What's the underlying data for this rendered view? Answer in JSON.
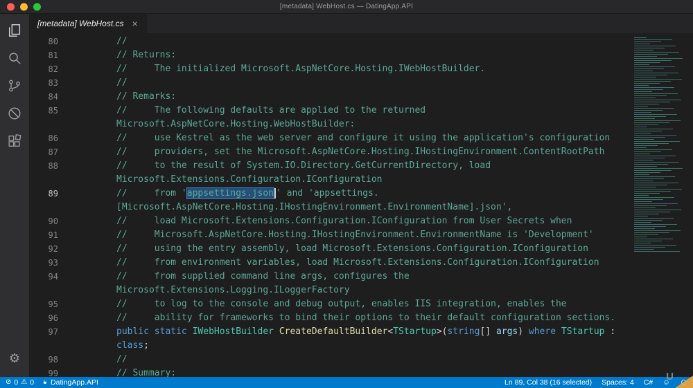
{
  "title_bar": {
    "title": "[metadata] WebHost.cs — DatingApp.API"
  },
  "tab": {
    "label": "[metadata] WebHost.cs"
  },
  "icons": {
    "close": "×",
    "gear": "⚙",
    "error": "⊘",
    "warning": "⚠",
    "smiley": "☺"
  },
  "activity_bar": {
    "icons": [
      "explorer",
      "search",
      "source-control",
      "debug",
      "extensions"
    ],
    "bottom": "settings-gear"
  },
  "editor": {
    "rows": [
      {
        "n": "80",
        "segs": [
          {
            "t": "//",
            "c": "com"
          }
        ]
      },
      {
        "n": "81",
        "segs": [
          {
            "t": "// Returns:",
            "c": "com"
          }
        ]
      },
      {
        "n": "82",
        "segs": [
          {
            "t": "//     The initialized Microsoft.AspNetCore.Hosting.IWebHostBuilder.",
            "c": "com"
          }
        ]
      },
      {
        "n": "83",
        "segs": [
          {
            "t": "//",
            "c": "com"
          }
        ]
      },
      {
        "n": "84",
        "segs": [
          {
            "t": "// Remarks:",
            "c": "com"
          }
        ]
      },
      {
        "n": "85",
        "segs": [
          {
            "t": "//     The following defaults are applied to the returned",
            "c": "com"
          }
        ]
      },
      {
        "n": "",
        "segs": [
          {
            "t": "Microsoft.AspNetCore.Hosting.WebHostBuilder:",
            "c": "com"
          }
        ]
      },
      {
        "n": "86",
        "segs": [
          {
            "t": "//     use Kestrel as the web server and configure it using the application's configuration",
            "c": "com"
          }
        ]
      },
      {
        "n": "87",
        "segs": [
          {
            "t": "//     providers, set the Microsoft.AspNetCore.Hosting.IHostingEnvironment.ContentRootPath",
            "c": "com"
          }
        ]
      },
      {
        "n": "88",
        "segs": [
          {
            "t": "//     to the result of System.IO.Directory.GetCurrentDirectory, load",
            "c": "com"
          }
        ]
      },
      {
        "n": "",
        "segs": [
          {
            "t": "Microsoft.Extensions.Configuration.IConfiguration",
            "c": "com"
          }
        ]
      },
      {
        "n": "89",
        "cur": true,
        "segs": [
          {
            "t": "//     from '",
            "c": "com"
          },
          {
            "t": "appsettings.json",
            "c": "com",
            "sel": true
          },
          {
            "t": "' and 'appsettings.",
            "c": "com"
          }
        ]
      },
      {
        "n": "",
        "segs": [
          {
            "t": "[Microsoft.AspNetCore.Hosting.IHostingEnvironment.EnvironmentName].json',",
            "c": "com"
          }
        ]
      },
      {
        "n": "90",
        "segs": [
          {
            "t": "//     load Microsoft.Extensions.Configuration.IConfiguration from User Secrets when",
            "c": "com"
          }
        ]
      },
      {
        "n": "91",
        "segs": [
          {
            "t": "//     Microsoft.AspNetCore.Hosting.IHostingEnvironment.EnvironmentName is 'Development'",
            "c": "com"
          }
        ]
      },
      {
        "n": "92",
        "segs": [
          {
            "t": "//     using the entry assembly, load Microsoft.Extensions.Configuration.IConfiguration",
            "c": "com"
          }
        ]
      },
      {
        "n": "93",
        "segs": [
          {
            "t": "//     from environment variables, load Microsoft.Extensions.Configuration.IConfiguration",
            "c": "com"
          }
        ]
      },
      {
        "n": "94",
        "segs": [
          {
            "t": "//     from supplied command line args, configures the",
            "c": "com"
          }
        ]
      },
      {
        "n": "",
        "segs": [
          {
            "t": "Microsoft.Extensions.Logging.ILoggerFactory",
            "c": "com"
          }
        ]
      },
      {
        "n": "95",
        "segs": [
          {
            "t": "//     to log to the console and debug output, enables IIS integration, enables the",
            "c": "com"
          }
        ]
      },
      {
        "n": "96",
        "segs": [
          {
            "t": "//     ability for frameworks to bind their options to their default configuration sections.",
            "c": "com"
          }
        ]
      },
      {
        "n": "97",
        "segs": [
          {
            "t": "public",
            "c": "kw"
          },
          {
            "t": " ",
            "c": "pl"
          },
          {
            "t": "static",
            "c": "kw"
          },
          {
            "t": " ",
            "c": "pl"
          },
          {
            "t": "IWebHostBuilder",
            "c": "ty"
          },
          {
            "t": " ",
            "c": "pl"
          },
          {
            "t": "CreateDefaultBuilder",
            "c": "fn"
          },
          {
            "t": "<",
            "c": "pl"
          },
          {
            "t": "TStartup",
            "c": "ty"
          },
          {
            "t": ">(",
            "c": "pl"
          },
          {
            "t": "string",
            "c": "kw"
          },
          {
            "t": "[] ",
            "c": "pl"
          },
          {
            "t": "args",
            "c": "pm"
          },
          {
            "t": ") ",
            "c": "pl"
          },
          {
            "t": "where",
            "c": "kw"
          },
          {
            "t": " ",
            "c": "pl"
          },
          {
            "t": "TStartup",
            "c": "ty"
          },
          {
            "t": " :",
            "c": "pl"
          }
        ]
      },
      {
        "n": "",
        "segs": [
          {
            "t": "class",
            "c": "kw"
          },
          {
            "t": ";",
            "c": "pl"
          }
        ]
      },
      {
        "n": "98",
        "segs": [
          {
            "t": "//",
            "c": "com"
          }
        ]
      },
      {
        "n": "99",
        "segs": [
          {
            "t": "// Summary:",
            "c": "com"
          }
        ]
      }
    ]
  },
  "status_bar": {
    "errors": "0",
    "warnings": "0",
    "project": "DatingApp.API",
    "cursor": "Ln 89, Col 38 (16 selected)",
    "indent": "Spaces: 4",
    "language": "C#"
  },
  "watermark": {
    "text": "U"
  },
  "colors": {
    "comment": "#5ca896",
    "keyword": "#569cd6",
    "type": "#4ec9b0",
    "function": "#dcdcaa",
    "param": "#9cdcfe",
    "plain": "#d4d4d4",
    "selection": "#264f78",
    "selection-border": "#3f7fbf",
    "statusbar": "#007acc",
    "linenumber": "#858585",
    "linenumber-active": "#c6c6c6"
  }
}
